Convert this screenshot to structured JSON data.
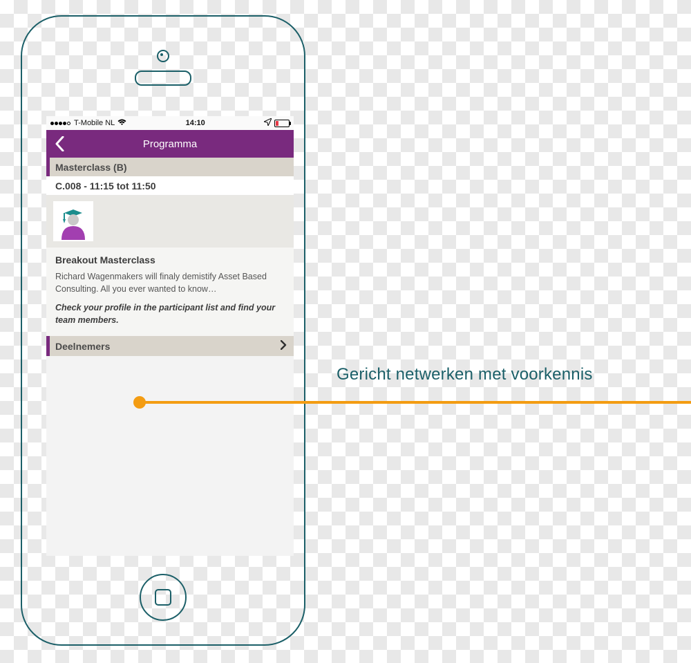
{
  "status_bar": {
    "carrier": "T-Mobile NL",
    "time": "14:10"
  },
  "navbar": {
    "title": "Programma"
  },
  "section_header": "Masterclass (B)",
  "session_time": "C.008 - 11:15 tot 11:50",
  "details": {
    "title": "Breakout Masterclass",
    "description": "Richard Wagenmakers will finaly demistify Asset Based Consulting. All you ever wanted to know…",
    "note": "Check your profile in the participant list and find your team members."
  },
  "participants_label": "Deelnemers",
  "callout": "Gericht netwerken met voorkennis",
  "colors": {
    "brand": "#792a7e",
    "teal": "#1b5f68",
    "orange": "#f39c12"
  }
}
